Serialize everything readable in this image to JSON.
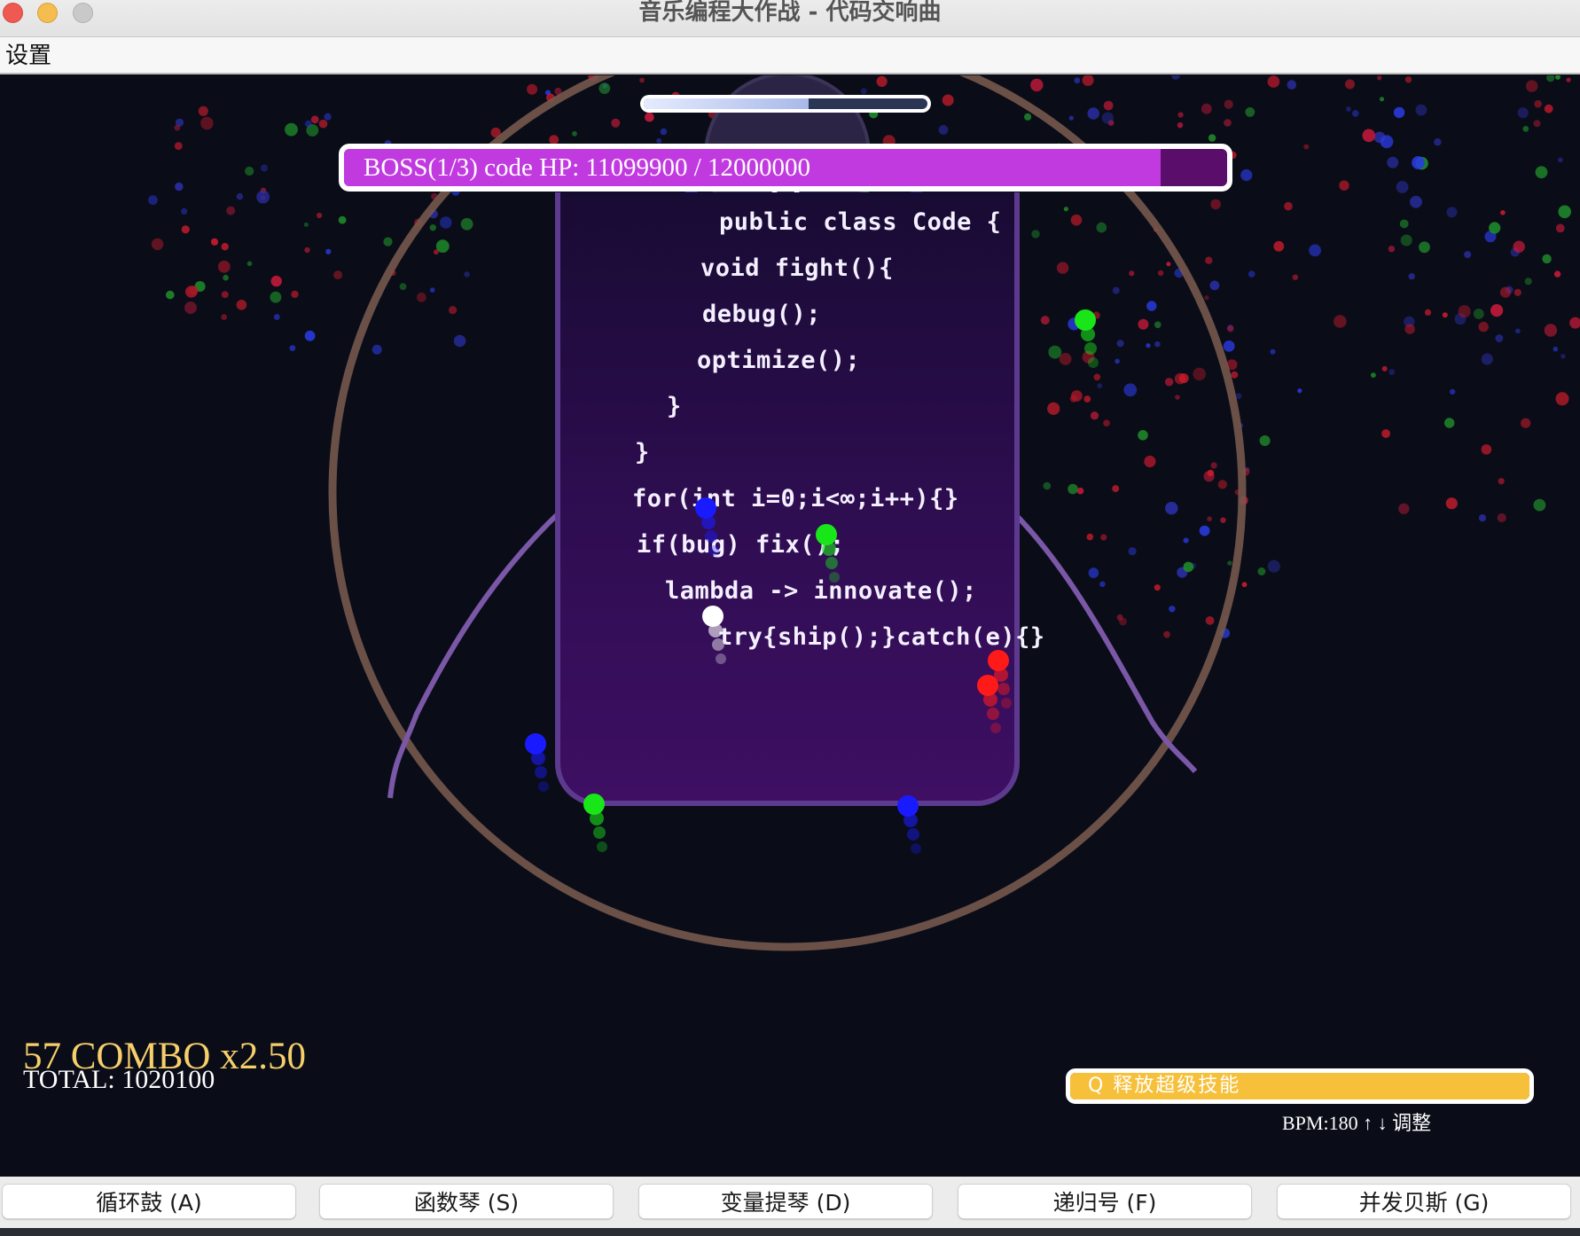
{
  "window": {
    "title": "音乐编程大作战 - 代码交响曲"
  },
  "menu": {
    "items": [
      "设置"
    ]
  },
  "boss": {
    "label": "BOSS(1/3) code HP: 11099900 / 12000000",
    "hp": 11099900,
    "max_hp": 12000000
  },
  "beat": {
    "progress": 0.58
  },
  "code_lines": [
    "public class Code {",
    "void fight(){",
    "debug();",
    "optimize();",
    "}",
    "}",
    "for(int i=0;i<∞;i++){}",
    "if(bug) fix();",
    "lambda -> innovate();",
    "try{ship();}catch(e){}"
  ],
  "hud": {
    "combo": "57 COMBO x2.50",
    "total": "TOTAL: 1020100",
    "skill_label": "Q 释放超级技能",
    "skill_charge": 1.0,
    "bpm": "BPM:180 ↑ ↓ 调整"
  },
  "instruments": [
    "循环鼓 (A)",
    "函数琴 (S)",
    "变量提琴 (D)",
    "递归号 (F)",
    "并发贝斯 (G)"
  ],
  "colors": {
    "background": "#0a0d18",
    "boss_fill": "#c13ae0",
    "skill_fill": "#f7c03b",
    "combo": "#f6cf6b",
    "note_red": "#ff1a1a",
    "note_green": "#19e619",
    "note_blue": "#1a1aff",
    "note_white": "#ffffff"
  }
}
